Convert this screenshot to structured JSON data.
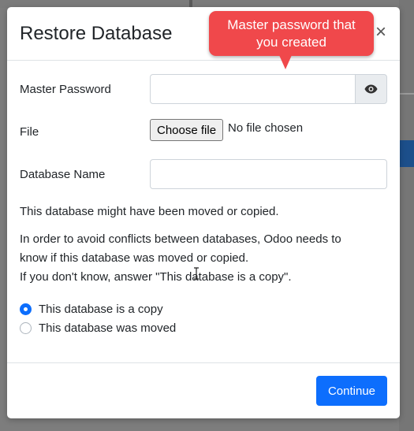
{
  "modal": {
    "title": "Restore Database",
    "close_label": "×"
  },
  "form": {
    "master_password": {
      "label": "Master Password",
      "value": "",
      "toggle_icon": "eye-icon"
    },
    "file": {
      "label": "File",
      "button_label": "Choose file",
      "status": "No file chosen"
    },
    "database_name": {
      "label": "Database Name",
      "value": ""
    }
  },
  "body_text": {
    "moved_notice": "This database might have been moved or copied.",
    "explanation_line1": "In order to avoid conflicts between databases, Odoo needs to",
    "explanation_line2": "know if this database was moved or copied.",
    "explanation_line3": "If you don't know, answer \"This database is a copy\"."
  },
  "options": [
    {
      "label": "This database is a copy",
      "checked": true
    },
    {
      "label": "This database was moved",
      "checked": false
    }
  ],
  "footer": {
    "continue_label": "Continue"
  },
  "annotation": {
    "text": "Master password that\nyou created"
  },
  "colors": {
    "primary": "#0d6efd",
    "callout": "#f0484b",
    "backdrop": "#7d7d7d"
  }
}
